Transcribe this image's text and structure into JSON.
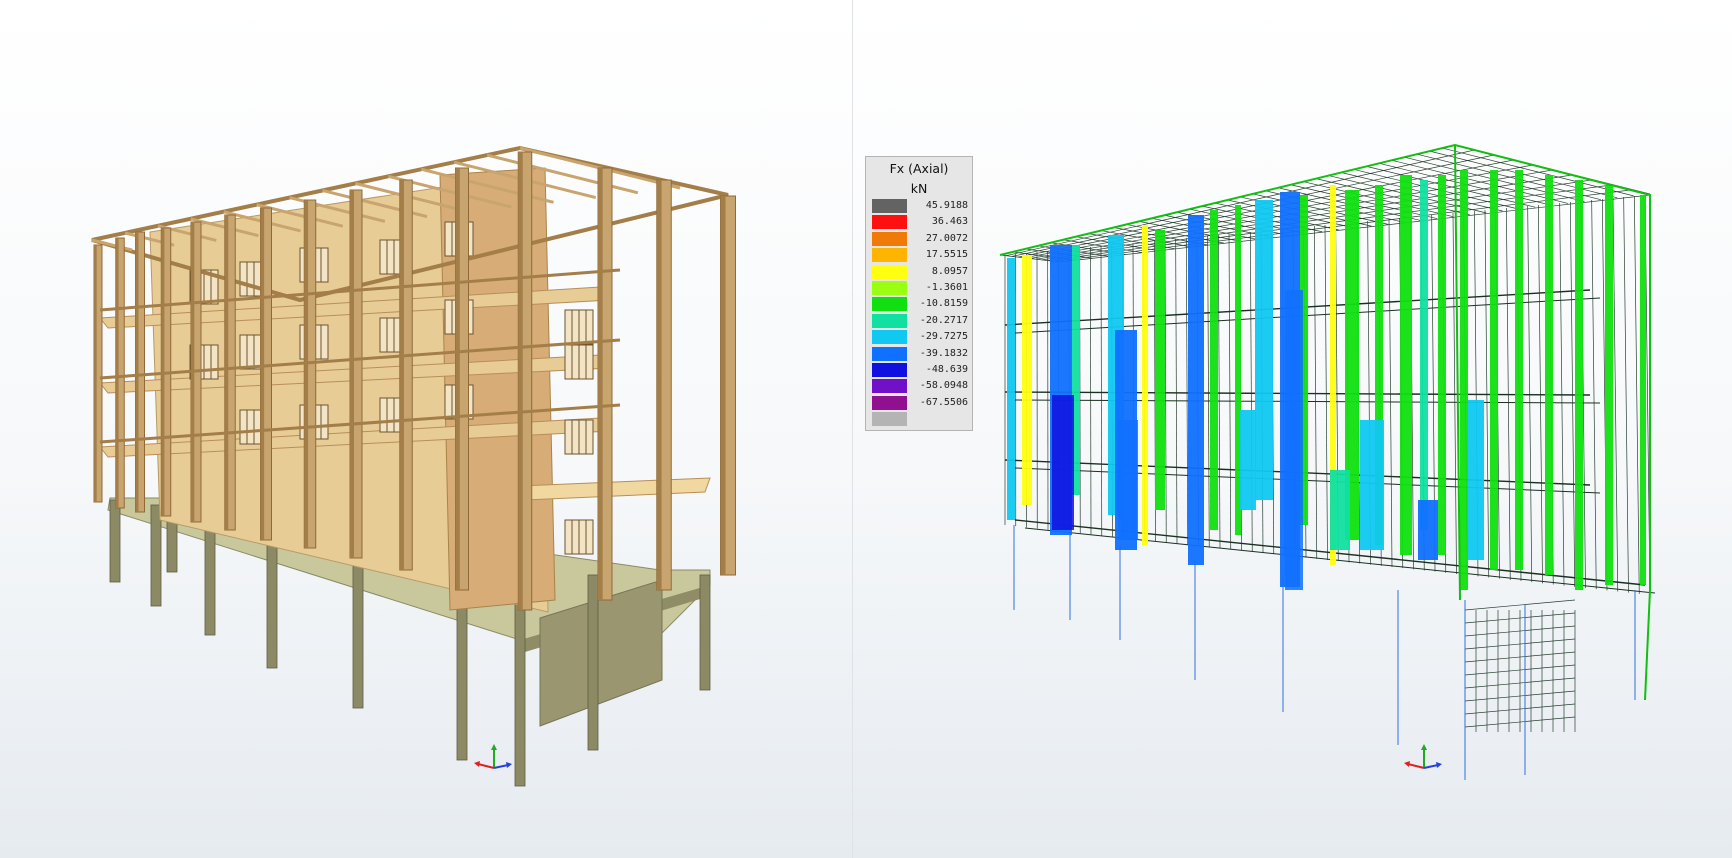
{
  "legend": {
    "title": "Fx (Axial)",
    "unit": "kN",
    "entries": [
      {
        "value": "45.9188",
        "color": "#636363"
      },
      {
        "value": "36.463",
        "color": "#ff1010"
      },
      {
        "value": "27.0072",
        "color": "#ef7a08"
      },
      {
        "value": "17.5515",
        "color": "#ffb400"
      },
      {
        "value": "8.0957",
        "color": "#ffff10"
      },
      {
        "value": "-1.3601",
        "color": "#9aff10"
      },
      {
        "value": "-10.8159",
        "color": "#10e010"
      },
      {
        "value": "-20.2717",
        "color": "#10e0a0"
      },
      {
        "value": "-29.7275",
        "color": "#10c8f0"
      },
      {
        "value": "-39.1832",
        "color": "#1070ff"
      },
      {
        "value": "-48.639",
        "color": "#1010e0"
      },
      {
        "value": "-58.0948",
        "color": "#7010c8"
      },
      {
        "value": "-67.5506",
        "color": "#901090"
      },
      {
        "value": "",
        "color": "#b4b4b4"
      }
    ]
  },
  "icons": {
    "triad_left": "axis-triad-icon",
    "triad_right": "axis-triad-icon"
  },
  "colors": {
    "timber": "#c8a46e",
    "timber_dark": "#a47e48",
    "timber_light": "#e8cc96",
    "concrete": "#8c8a64",
    "podium": "#c8c89c",
    "mesh": "#284030"
  }
}
